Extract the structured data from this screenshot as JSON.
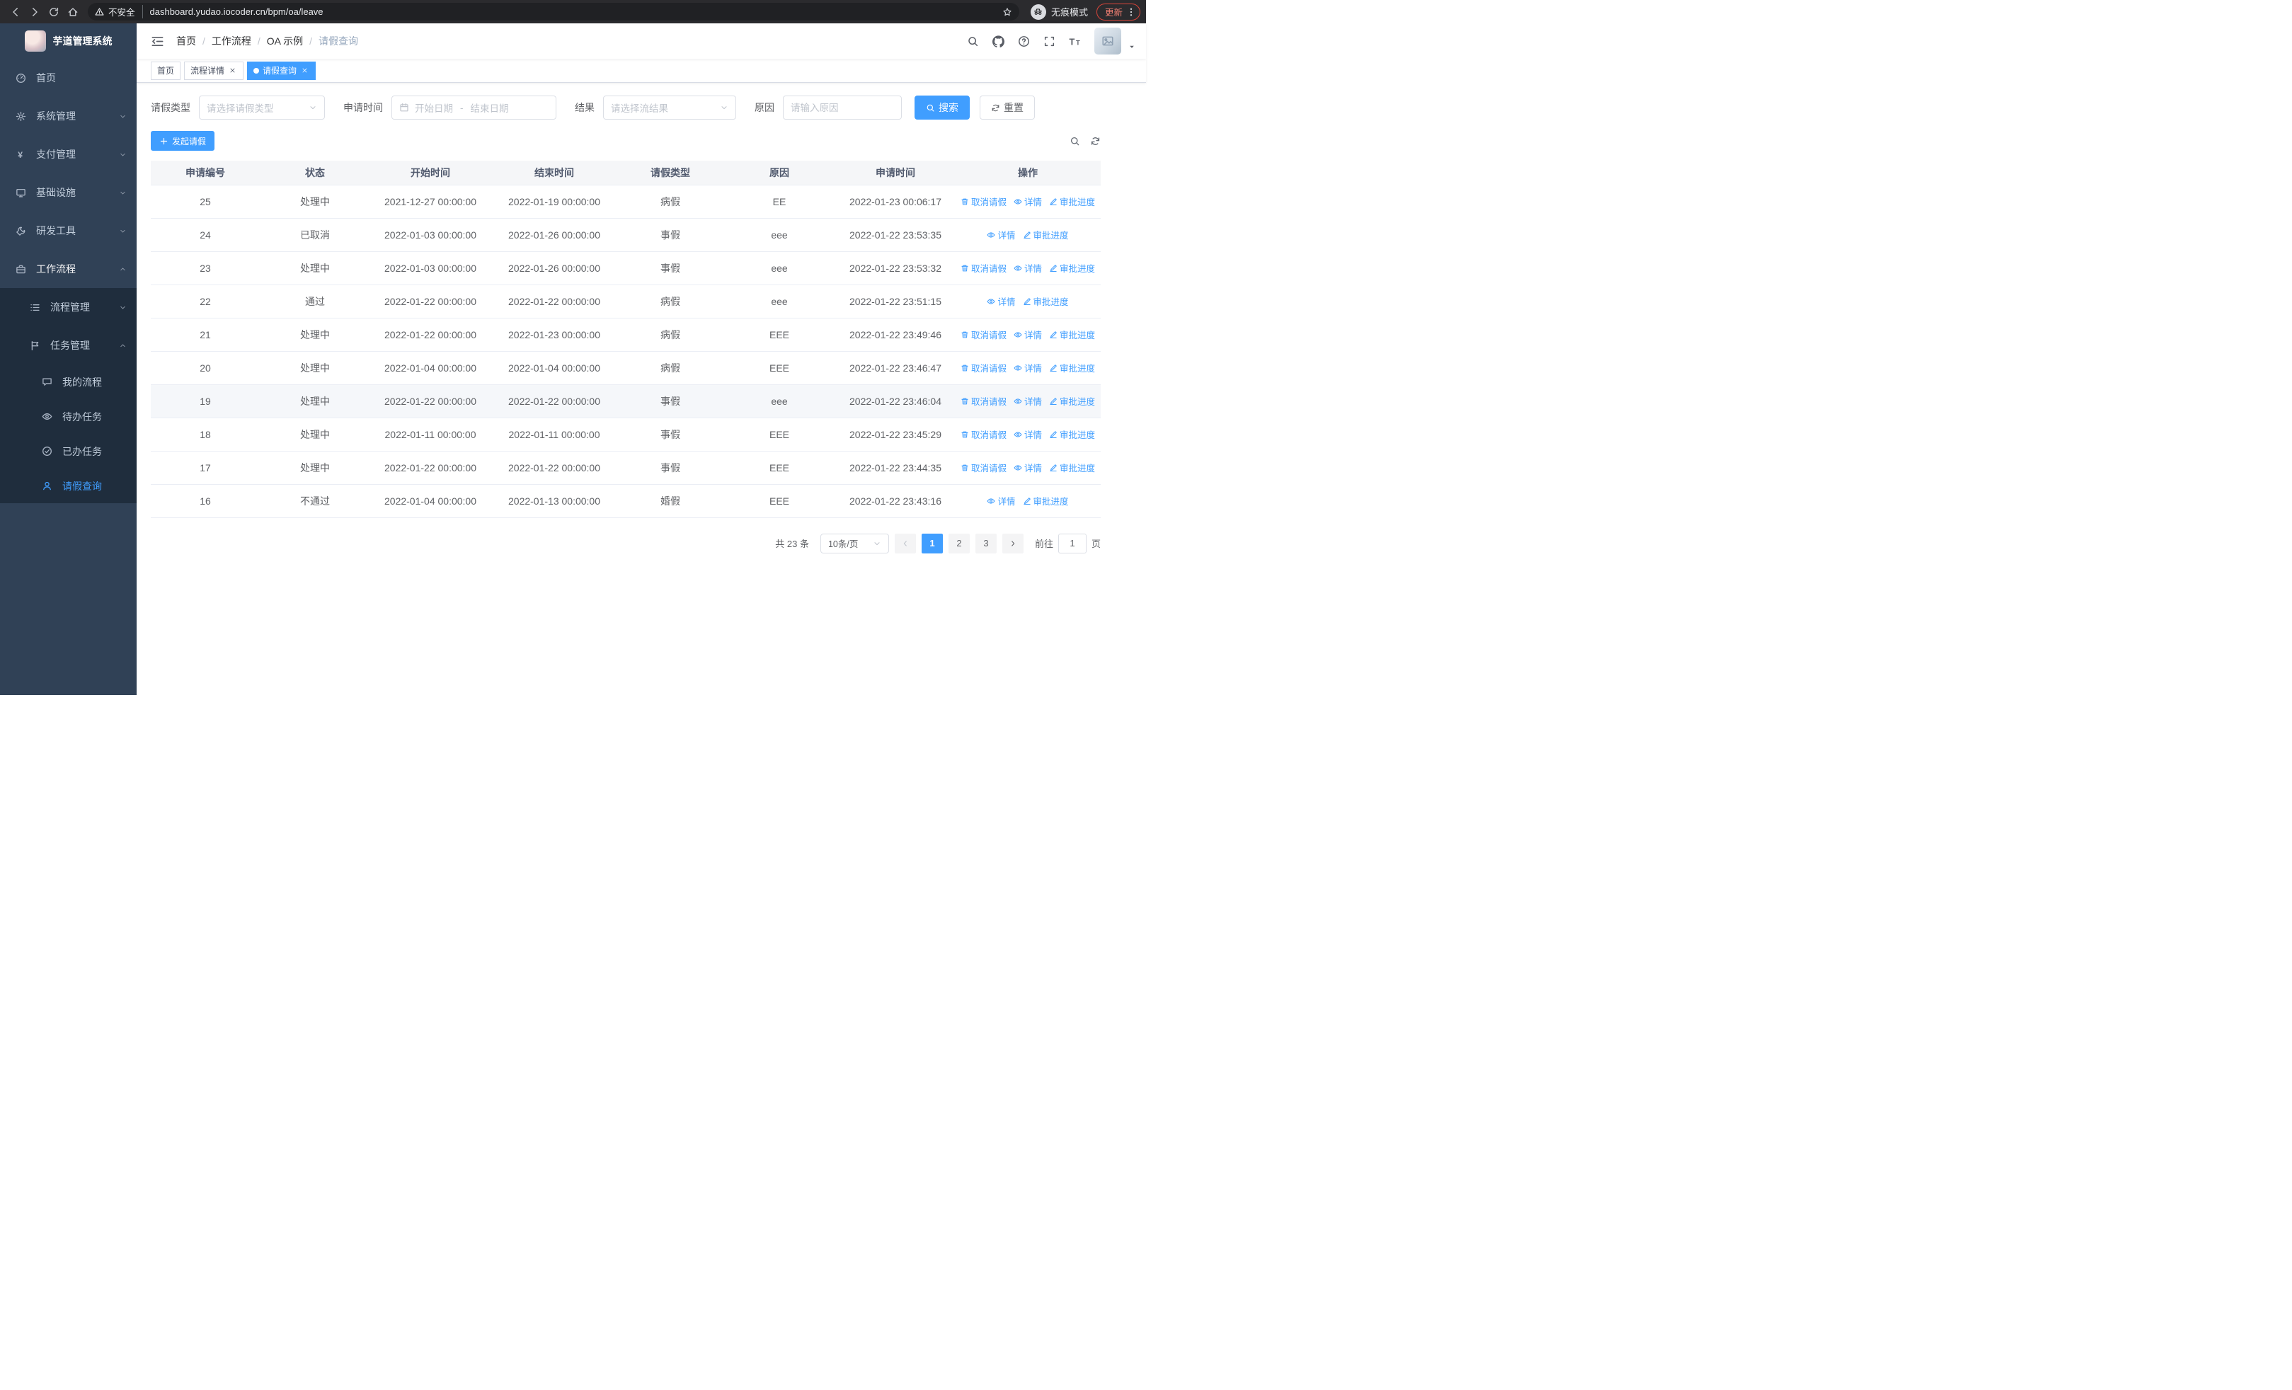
{
  "browser": {
    "security_label": "不安全",
    "url": "dashboard.yudao.iocoder.cn/bpm/oa/leave",
    "incognito_label": "无痕模式",
    "update_label": "更新"
  },
  "sidebar": {
    "title": "芋道管理系统",
    "menu": [
      {
        "label": "首页"
      },
      {
        "label": "系统管理"
      },
      {
        "label": "支付管理"
      },
      {
        "label": "基础设施"
      },
      {
        "label": "研发工具"
      },
      {
        "label": "工作流程"
      },
      {
        "label": "流程管理"
      },
      {
        "label": "任务管理"
      },
      {
        "label": "我的流程"
      },
      {
        "label": "待办任务"
      },
      {
        "label": "已办任务"
      },
      {
        "label": "请假查询"
      }
    ]
  },
  "navbar": {
    "breadcrumb": [
      "首页",
      "工作流程",
      "OA 示例",
      "请假查询"
    ],
    "separator": "/"
  },
  "tabs": [
    {
      "label": "首页"
    },
    {
      "label": "流程详情"
    },
    {
      "label": "请假查询"
    }
  ],
  "filters": {
    "leave_type_label": "请假类型",
    "leave_type_placeholder": "请选择请假类型",
    "apply_time_label": "申请时间",
    "start_date_placeholder": "开始日期",
    "range_separator": "-",
    "end_date_placeholder": "结束日期",
    "result_label": "结果",
    "result_placeholder": "请选择流结果",
    "reason_label": "原因",
    "reason_placeholder": "请输入原因",
    "search_button": "搜索",
    "reset_button": "重置"
  },
  "toolbar": {
    "create_button": "发起请假"
  },
  "table": {
    "columns": [
      "申请编号",
      "状态",
      "开始时间",
      "结束时间",
      "请假类型",
      "原因",
      "申请时间",
      "操作"
    ],
    "action_labels": {
      "cancel": "取消请假",
      "detail": "详情",
      "progress": "审批进度"
    },
    "rows": [
      {
        "id": "25",
        "status": "处理中",
        "start_time": "2021-12-27 00:00:00",
        "end_time": "2022-01-19 00:00:00",
        "leave_type": "病假",
        "reason": "EE",
        "apply_time": "2022-01-23 00:06:17",
        "actions": [
          "cancel",
          "detail",
          "progress"
        ],
        "highlighted": false
      },
      {
        "id": "24",
        "status": "已取消",
        "start_time": "2022-01-03 00:00:00",
        "end_time": "2022-01-26 00:00:00",
        "leave_type": "事假",
        "reason": "eee",
        "apply_time": "2022-01-22 23:53:35",
        "actions": [
          "detail",
          "progress"
        ],
        "highlighted": false
      },
      {
        "id": "23",
        "status": "处理中",
        "start_time": "2022-01-03 00:00:00",
        "end_time": "2022-01-26 00:00:00",
        "leave_type": "事假",
        "reason": "eee",
        "apply_time": "2022-01-22 23:53:32",
        "actions": [
          "cancel",
          "detail",
          "progress"
        ],
        "highlighted": false
      },
      {
        "id": "22",
        "status": "通过",
        "start_time": "2022-01-22 00:00:00",
        "end_time": "2022-01-22 00:00:00",
        "leave_type": "病假",
        "reason": "eee",
        "apply_time": "2022-01-22 23:51:15",
        "actions": [
          "detail",
          "progress"
        ],
        "highlighted": false
      },
      {
        "id": "21",
        "status": "处理中",
        "start_time": "2022-01-22 00:00:00",
        "end_time": "2022-01-23 00:00:00",
        "leave_type": "病假",
        "reason": "EEE",
        "apply_time": "2022-01-22 23:49:46",
        "actions": [
          "cancel",
          "detail",
          "progress"
        ],
        "highlighted": false
      },
      {
        "id": "20",
        "status": "处理中",
        "start_time": "2022-01-04 00:00:00",
        "end_time": "2022-01-04 00:00:00",
        "leave_type": "病假",
        "reason": "EEE",
        "apply_time": "2022-01-22 23:46:47",
        "actions": [
          "cancel",
          "detail",
          "progress"
        ],
        "highlighted": false
      },
      {
        "id": "19",
        "status": "处理中",
        "start_time": "2022-01-22 00:00:00",
        "end_time": "2022-01-22 00:00:00",
        "leave_type": "事假",
        "reason": "eee",
        "apply_time": "2022-01-22 23:46:04",
        "actions": [
          "cancel",
          "detail",
          "progress"
        ],
        "highlighted": true
      },
      {
        "id": "18",
        "status": "处理中",
        "start_time": "2022-01-11 00:00:00",
        "end_time": "2022-01-11 00:00:00",
        "leave_type": "事假",
        "reason": "EEE",
        "apply_time": "2022-01-22 23:45:29",
        "actions": [
          "cancel",
          "detail",
          "progress"
        ],
        "highlighted": false
      },
      {
        "id": "17",
        "status": "处理中",
        "start_time": "2022-01-22 00:00:00",
        "end_time": "2022-01-22 00:00:00",
        "leave_type": "事假",
        "reason": "EEE",
        "apply_time": "2022-01-22 23:44:35",
        "actions": [
          "cancel",
          "detail",
          "progress"
        ],
        "highlighted": false
      },
      {
        "id": "16",
        "status": "不通过",
        "start_time": "2022-01-04 00:00:00",
        "end_time": "2022-01-13 00:00:00",
        "leave_type": "婚假",
        "reason": "EEE",
        "apply_time": "2022-01-22 23:43:16",
        "actions": [
          "detail",
          "progress"
        ],
        "highlighted": false
      }
    ]
  },
  "pagination": {
    "total": "共 23 条",
    "page_size": "10条/页",
    "pages": [
      "1",
      "2",
      "3"
    ],
    "current": "1",
    "goto_label": "前往",
    "goto_value": "1",
    "goto_suffix": "页"
  },
  "colors": {
    "primary": "#409eff",
    "sidebar_bg": "#304156",
    "submenu_bg": "#1f2d3d"
  }
}
